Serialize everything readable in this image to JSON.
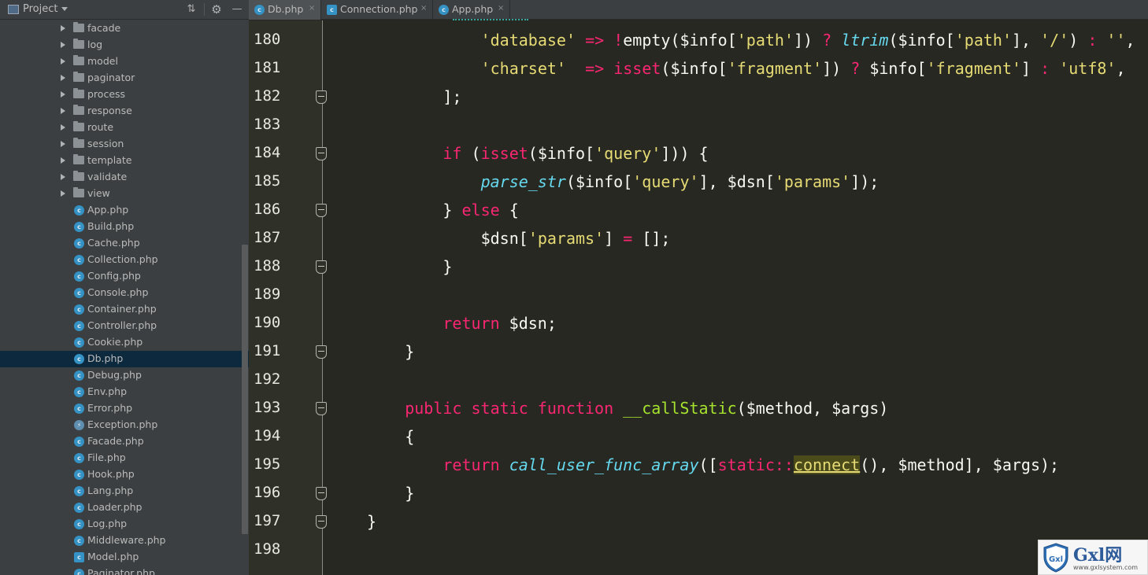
{
  "project_panel": {
    "title": "Project",
    "icons": {
      "collapse": "collapse-all-icon",
      "settings": "gear-icon",
      "hide": "hide-panel-icon"
    },
    "tree": [
      {
        "type": "folder",
        "name": "facade"
      },
      {
        "type": "folder",
        "name": "log"
      },
      {
        "type": "folder",
        "name": "model"
      },
      {
        "type": "folder",
        "name": "paginator"
      },
      {
        "type": "folder",
        "name": "process"
      },
      {
        "type": "folder",
        "name": "response"
      },
      {
        "type": "folder",
        "name": "route"
      },
      {
        "type": "folder",
        "name": "session"
      },
      {
        "type": "folder",
        "name": "template"
      },
      {
        "type": "folder",
        "name": "validate"
      },
      {
        "type": "folder",
        "name": "view"
      },
      {
        "type": "class",
        "name": "App.php"
      },
      {
        "type": "class",
        "name": "Build.php"
      },
      {
        "type": "class",
        "name": "Cache.php"
      },
      {
        "type": "class",
        "name": "Collection.php"
      },
      {
        "type": "class",
        "name": "Config.php"
      },
      {
        "type": "class",
        "name": "Console.php"
      },
      {
        "type": "class",
        "name": "Container.php"
      },
      {
        "type": "class",
        "name": "Controller.php"
      },
      {
        "type": "class",
        "name": "Cookie.php"
      },
      {
        "type": "class",
        "name": "Db.php",
        "selected": true
      },
      {
        "type": "class",
        "name": "Debug.php"
      },
      {
        "type": "class",
        "name": "Env.php"
      },
      {
        "type": "class",
        "name": "Error.php"
      },
      {
        "type": "exception",
        "name": "Exception.php"
      },
      {
        "type": "class",
        "name": "Facade.php"
      },
      {
        "type": "class",
        "name": "File.php"
      },
      {
        "type": "class",
        "name": "Hook.php"
      },
      {
        "type": "class",
        "name": "Lang.php"
      },
      {
        "type": "class",
        "name": "Loader.php"
      },
      {
        "type": "class",
        "name": "Log.php"
      },
      {
        "type": "class",
        "name": "Middleware.php"
      },
      {
        "type": "abstract",
        "name": "Model.php"
      },
      {
        "type": "class",
        "name": "Paginator.php"
      }
    ]
  },
  "tabs": [
    {
      "label": "Db.php",
      "active": true,
      "icon": "class-icon"
    },
    {
      "label": "Connection.php",
      "active": false,
      "icon": "abstract-class-icon"
    },
    {
      "label": "App.php",
      "active": false,
      "icon": "class-icon"
    }
  ],
  "tab_close_glyph": "×",
  "code_lines": [
    {
      "num": "180",
      "fold": false,
      "indent": 12,
      "tokens": [
        [
          "s",
          "'database'"
        ],
        [
          "p",
          " "
        ],
        [
          "k",
          "=>"
        ],
        [
          "p",
          " "
        ],
        [
          "k",
          "!"
        ],
        [
          "p",
          "empty($info["
        ],
        [
          "s",
          "'path'"
        ],
        [
          "p",
          "]) "
        ],
        [
          "k",
          "?"
        ],
        [
          "p",
          " "
        ],
        [
          "f",
          "ltrim"
        ],
        [
          "p",
          "($info["
        ],
        [
          "s",
          "'path'"
        ],
        [
          "p",
          "], "
        ],
        [
          "s",
          "'/'"
        ],
        [
          "p",
          ") "
        ],
        [
          "k",
          ":"
        ],
        [
          "p",
          " "
        ],
        [
          "s",
          "''"
        ],
        [
          "p",
          ","
        ]
      ]
    },
    {
      "num": "181",
      "fold": false,
      "indent": 12,
      "tokens": [
        [
          "s",
          "'charset'"
        ],
        [
          "p",
          "  "
        ],
        [
          "k",
          "=>"
        ],
        [
          "p",
          " "
        ],
        [
          "k",
          "isset"
        ],
        [
          "p",
          "($info["
        ],
        [
          "s",
          "'fragment'"
        ],
        [
          "p",
          "]) "
        ],
        [
          "k",
          "?"
        ],
        [
          "p",
          " $info["
        ],
        [
          "s",
          "'fragment'"
        ],
        [
          "p",
          "] "
        ],
        [
          "k",
          ":"
        ],
        [
          "p",
          " "
        ],
        [
          "s",
          "'utf8'"
        ],
        [
          "p",
          ","
        ]
      ]
    },
    {
      "num": "182",
      "fold": true,
      "indent": 8,
      "tokens": [
        [
          "p",
          "];"
        ]
      ]
    },
    {
      "num": "183",
      "fold": false,
      "indent": 0,
      "tokens": []
    },
    {
      "num": "184",
      "fold": true,
      "indent": 8,
      "tokens": [
        [
          "k",
          "if"
        ],
        [
          "p",
          " ("
        ],
        [
          "k",
          "isset"
        ],
        [
          "p",
          "($info["
        ],
        [
          "s",
          "'query'"
        ],
        [
          "p",
          "])) {"
        ]
      ]
    },
    {
      "num": "185",
      "fold": false,
      "indent": 12,
      "tokens": [
        [
          "f",
          "parse_str"
        ],
        [
          "p",
          "($info["
        ],
        [
          "s",
          "'query'"
        ],
        [
          "p",
          "], $dsn["
        ],
        [
          "s",
          "'params'"
        ],
        [
          "p",
          "]);"
        ]
      ]
    },
    {
      "num": "186",
      "fold": true,
      "indent": 8,
      "tokens": [
        [
          "p",
          "} "
        ],
        [
          "k",
          "else"
        ],
        [
          "p",
          " {"
        ]
      ]
    },
    {
      "num": "187",
      "fold": false,
      "indent": 12,
      "tokens": [
        [
          "p",
          "$dsn["
        ],
        [
          "s",
          "'params'"
        ],
        [
          "p",
          "] "
        ],
        [
          "k",
          "="
        ],
        [
          "p",
          " [];"
        ]
      ]
    },
    {
      "num": "188",
      "fold": true,
      "indent": 8,
      "tokens": [
        [
          "p",
          "}"
        ]
      ]
    },
    {
      "num": "189",
      "fold": false,
      "indent": 0,
      "tokens": []
    },
    {
      "num": "190",
      "fold": false,
      "indent": 8,
      "tokens": [
        [
          "k",
          "return"
        ],
        [
          "p",
          " $dsn;"
        ]
      ]
    },
    {
      "num": "191",
      "fold": true,
      "indent": 4,
      "tokens": [
        [
          "p",
          "}"
        ]
      ]
    },
    {
      "num": "192",
      "fold": false,
      "indent": 0,
      "tokens": []
    },
    {
      "num": "193",
      "fold": true,
      "indent": 4,
      "tokens": [
        [
          "k",
          "public"
        ],
        [
          "p",
          " "
        ],
        [
          "k",
          "static"
        ],
        [
          "p",
          " "
        ],
        [
          "k",
          "function"
        ],
        [
          "p",
          " "
        ],
        [
          "g",
          "__callStatic"
        ],
        [
          "p",
          "($method, $args)"
        ]
      ]
    },
    {
      "num": "194",
      "fold": false,
      "indent": 4,
      "tokens": [
        [
          "p",
          "{"
        ]
      ]
    },
    {
      "num": "195",
      "fold": false,
      "indent": 8,
      "tokens": [
        [
          "k",
          "return"
        ],
        [
          "p",
          " "
        ],
        [
          "f",
          "call_user_func_array"
        ],
        [
          "p",
          "(["
        ],
        [
          "k",
          "static::"
        ],
        [
          "hl",
          "connect"
        ],
        [
          "p",
          "(), $method], $args);"
        ]
      ]
    },
    {
      "num": "196",
      "fold": true,
      "indent": 4,
      "tokens": [
        [
          "p",
          "}"
        ]
      ]
    },
    {
      "num": "197",
      "fold": true,
      "indent": 0,
      "tokens": [
        [
          "p",
          "}"
        ]
      ]
    },
    {
      "num": "198",
      "fold": false,
      "indent": 0,
      "tokens": []
    }
  ],
  "colors": {
    "keyword": "#f92672",
    "string": "#e6db74",
    "function": "#66d9ef",
    "declaration": "#a6e22e",
    "plain": "#f8f8f2",
    "editor_bg": "#272822",
    "panel_bg": "#3c3f41",
    "selection": "#0d293e"
  },
  "watermark": {
    "brand": "Gxl网",
    "url": "www.gxlsystem.com",
    "shield_text": "Gxl"
  }
}
